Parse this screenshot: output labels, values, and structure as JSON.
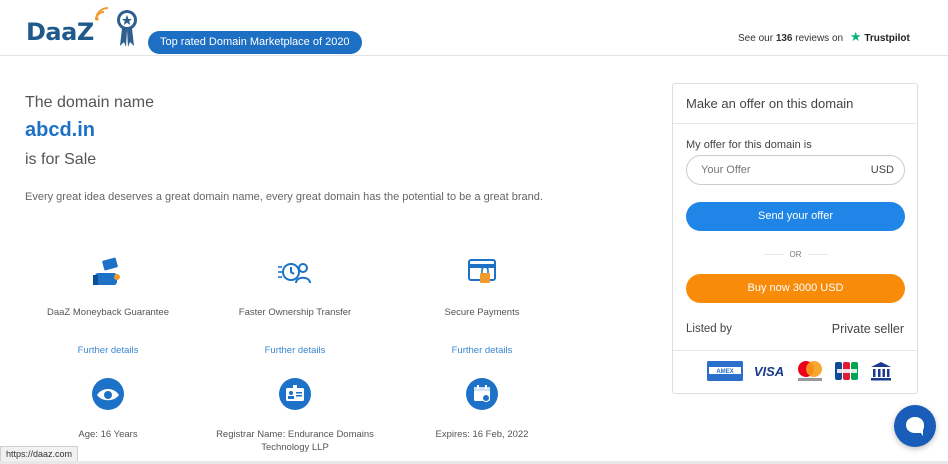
{
  "header": {
    "logo_text": "DaaZ",
    "badge": "Top rated Domain Marketplace of 2020",
    "reviews_prefix": "See our",
    "reviews_count": "136",
    "reviews_suffix": "reviews on",
    "trustpilot": "Trustpilot"
  },
  "hero": {
    "line1": "The domain name",
    "domain": "abcd.in",
    "line3": "is for Sale",
    "tagline": "Every great idea deserves a great domain name, every great domain has the potential to be a great brand."
  },
  "features": [
    {
      "label": "DaaZ Moneyback Guarantee",
      "link": "Further details",
      "icon": "moneyback-icon"
    },
    {
      "label": "Faster Ownership Transfer",
      "link": "Further details",
      "icon": "transfer-icon"
    },
    {
      "label": "Secure Payments",
      "link": "Further details",
      "icon": "secure-payment-icon"
    }
  ],
  "facts": [
    {
      "label": "Age: 16 Years",
      "icon": "eye-icon"
    },
    {
      "label": "Registrar Name: Endurance Domains Technology LLP",
      "icon": "id-card-icon"
    },
    {
      "label": "Expires: 16 Feb, 2022",
      "icon": "calendar-icon"
    }
  ],
  "offer_panel": {
    "title": "Make an offer on this domain",
    "offer_label": "My offer for this domain is",
    "offer_placeholder": "Your Offer",
    "offer_value": "",
    "currency": "USD",
    "send_button": "Send your offer",
    "or_text": "OR",
    "buy_button": "Buy now 3000 USD",
    "listed_by_label": "Listed by",
    "listed_by_value": "Private seller",
    "payment_methods": [
      "American Express",
      "VISA",
      "Mastercard",
      "JCB",
      "Bank transfer"
    ]
  },
  "status_bar": {
    "url": "https://daaz.com"
  },
  "colors": {
    "brand_blue": "#1d72c8",
    "send_button": "#1f86e8",
    "buy_button": "#f98b0b",
    "trustpilot_green": "#00b67a"
  }
}
